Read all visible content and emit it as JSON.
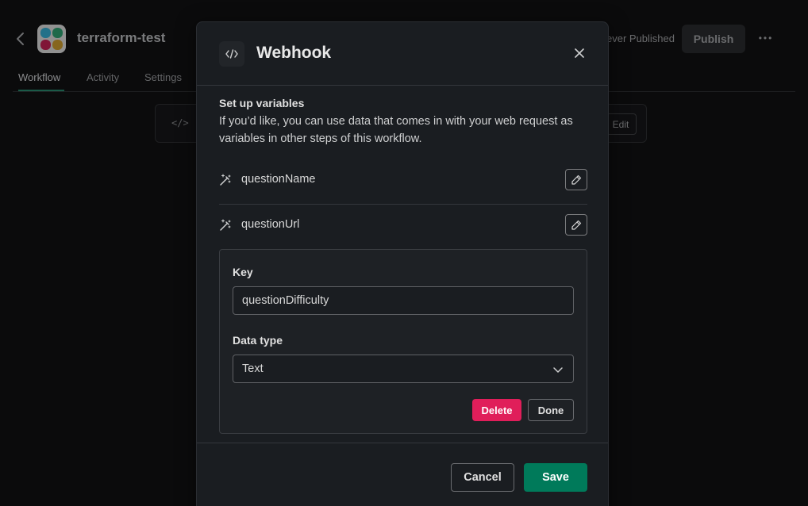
{
  "background": {
    "app_title": "terraform-test",
    "status_text": "ever Published",
    "publish_label": "Publish",
    "more_label": "•••",
    "tabs": [
      {
        "label": "Workflow",
        "active": true
      },
      {
        "label": "Activity",
        "active": false
      },
      {
        "label": "Settings",
        "active": false
      }
    ],
    "card_icon": "</>",
    "card_edit_label": "Edit",
    "logo_colors": [
      "#36c5f0",
      "#2eb67d",
      "#e01e5a",
      "#ecb22e"
    ],
    "icons": {
      "back": "chevron-left-icon",
      "more": "ellipsis-icon",
      "webhook": "code-icon"
    }
  },
  "modal": {
    "title": "Webhook",
    "header_icon": "code-icon",
    "close_icon": "close-icon",
    "setup": {
      "title": "Set up variables",
      "description": "If you’d like, you can use data that comes in with your web request as variables in other steps of this workflow."
    },
    "variables": [
      {
        "name": "questionName",
        "icon": "magic-wand-icon",
        "edit_icon": "pencil-icon"
      },
      {
        "name": "questionUrl",
        "icon": "magic-wand-icon",
        "edit_icon": "pencil-icon"
      }
    ],
    "editor": {
      "key_label": "Key",
      "key_value": "questionDifficulty",
      "data_type_label": "Data type",
      "data_type_value": "Text",
      "delete_label": "Delete",
      "done_label": "Done"
    },
    "footer": {
      "cancel_label": "Cancel",
      "save_label": "Save"
    }
  },
  "colors": {
    "accent_save": "#007a5a",
    "danger_delete": "#e01e5a",
    "modal_bg": "#1a1d21"
  }
}
